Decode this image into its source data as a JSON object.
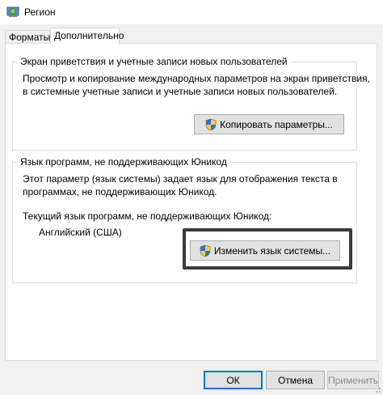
{
  "window": {
    "title": "Регион"
  },
  "tabs": [
    {
      "label": "Форматы"
    },
    {
      "label": "Дополнительно"
    }
  ],
  "welcome_group": {
    "legend": "Экран приветствия и учетные записи новых пользователей",
    "description_line1": "Просмотр и копирование международных параметров на экран приветствия,",
    "description_line2": "в системные учетные записи и учетные записи новых пользователей.",
    "copy_button_label": "Копировать параметры..."
  },
  "unicode_group": {
    "legend": "Язык программ, не поддерживающих Юникод",
    "description_line1": "Этот параметр (язык системы) задает язык для отображения текста в",
    "description_line2": "программах, не поддерживающих Юникод.",
    "current_label": "Текущий язык программ, не поддерживающих Юникод:",
    "current_value": "Английский (США)",
    "change_button_label": "Изменить язык системы..."
  },
  "footer": {
    "ok_label": "ОК",
    "cancel_label": "Отмена",
    "apply_label": "Применить"
  },
  "colors": {
    "accent": "#0078d7",
    "highlight_border": "#3a3a3a"
  }
}
